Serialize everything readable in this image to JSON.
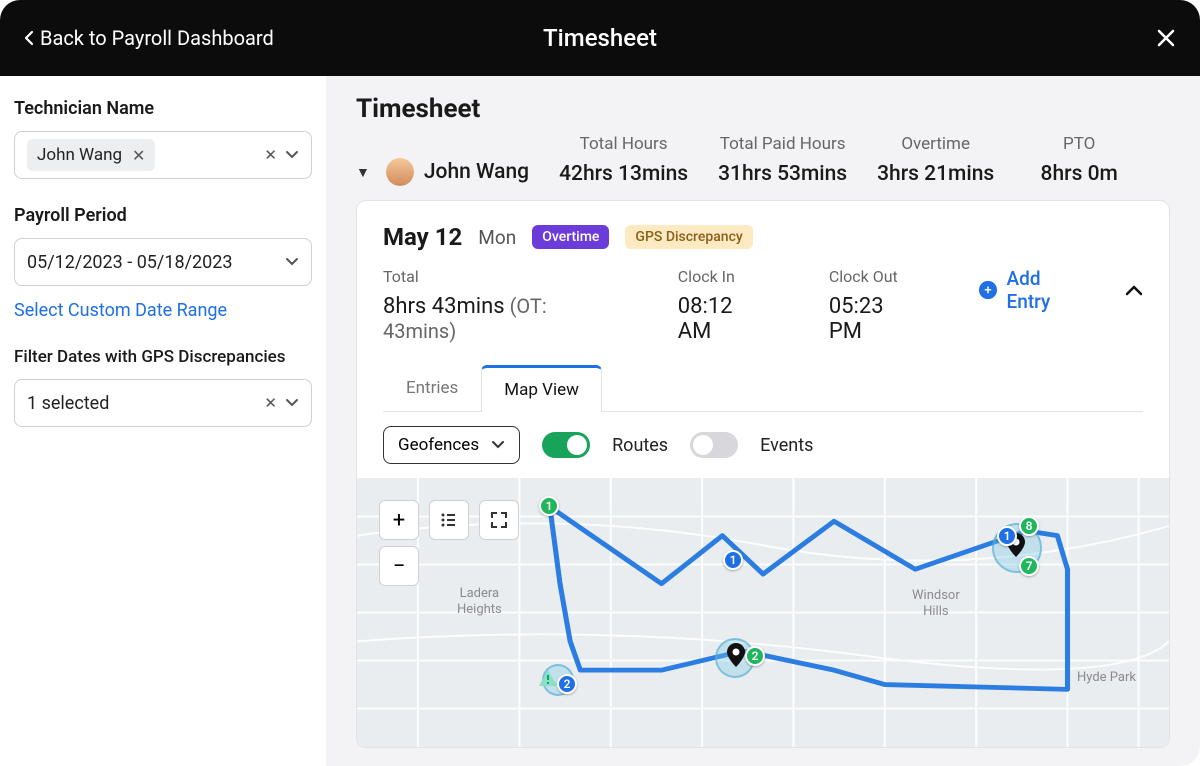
{
  "header": {
    "back_label": "Back to Payroll Dashboard",
    "title": "Timesheet"
  },
  "filters": {
    "technician_label": "Technician Name",
    "technician_chip": "John Wang",
    "payroll_period_label": "Payroll Period",
    "payroll_period_value": "05/12/2023 - 05/18/2023",
    "custom_range_link": "Select Custom Date Range",
    "gps_filter_label": "Filter Dates with GPS Discrepancies",
    "gps_filter_value": "1 selected"
  },
  "summary": {
    "title": "Timesheet",
    "technician_name": "John Wang",
    "stats": {
      "total_hours": {
        "label": "Total Hours",
        "value": "42hrs 13mins"
      },
      "paid_hours": {
        "label": "Total Paid Hours",
        "value": "31hrs 53mins"
      },
      "overtime": {
        "label": "Overtime",
        "value": "3hrs 21mins"
      },
      "pto": {
        "label": "PTO",
        "value": "8hrs 0m"
      }
    }
  },
  "day": {
    "date": "May 12",
    "dow": "Mon",
    "badges": {
      "overtime": "Overtime",
      "gps": "GPS Discrepancy"
    },
    "total": {
      "label": "Total",
      "value": "8hrs 43mins",
      "ot_suffix": " (OT: 43mins)"
    },
    "clock_in": {
      "label": "Clock In",
      "value": "08:12 AM"
    },
    "clock_out": {
      "label": "Clock Out",
      "value": "05:23 PM"
    },
    "add_entry_label": "Add Entry",
    "tabs": {
      "entries": "Entries",
      "map_view": "Map View"
    },
    "map_toolbar": {
      "geofences": "Geofences",
      "routes": "Routes",
      "events": "Events"
    }
  },
  "map": {
    "labels": {
      "ladera": "Ladera\nHeights",
      "windsor": "Windsor\nHills",
      "hyde": "Hyde Park"
    }
  }
}
